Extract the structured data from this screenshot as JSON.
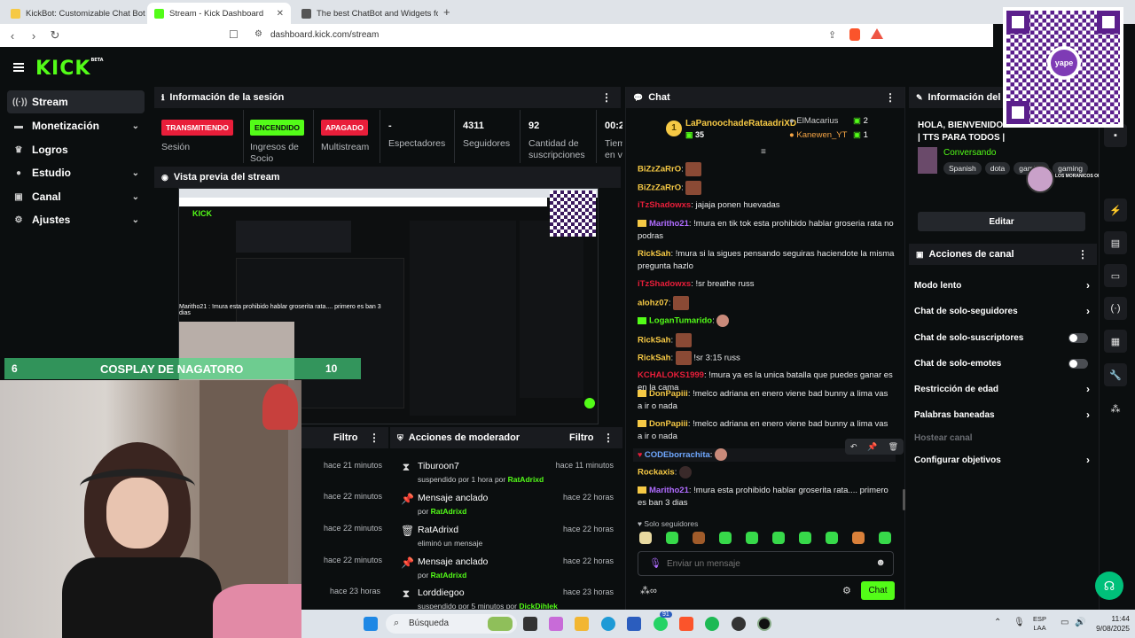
{
  "browser": {
    "tabs": [
      {
        "title": "KickBot: Customizable Chat Bot for K"
      },
      {
        "title": "Stream - Kick Dashboard"
      },
      {
        "title": "The best ChatBot and Widgets for Ki"
      }
    ],
    "url": "dashboard.kick.com/stream"
  },
  "header": {
    "logo": "KICK",
    "logo_sup": "BETA"
  },
  "sidebar": {
    "items": [
      {
        "label": "Stream",
        "icon": "stream-icon"
      },
      {
        "label": "Monetización",
        "icon": "monetization-icon"
      },
      {
        "label": "Logros",
        "icon": "trophy-icon"
      },
      {
        "label": "Estudio",
        "icon": "studio-icon"
      },
      {
        "label": "Canal",
        "icon": "channel-icon"
      },
      {
        "label": "Ajustes",
        "icon": "gear-icon"
      }
    ]
  },
  "session": {
    "title": "Información de la sesión",
    "stats": [
      {
        "badge": "TRANSMITIENDO",
        "label": "Sesión",
        "color": "#e91e3a"
      },
      {
        "badge": "ENCENDIDO",
        "label": "Ingresos de\nSocio",
        "color": "#53fc18"
      },
      {
        "badge": "APAGADO",
        "label": "Multistream",
        "color": "#e91e3a"
      },
      {
        "value": "-",
        "label": "Espectadores"
      },
      {
        "value": "4311",
        "label": "Seguidores"
      },
      {
        "value": "92",
        "label": "Cantidad de\nsuscripciones"
      },
      {
        "value": "00:2",
        "label": "Tiem\nen vi"
      }
    ]
  },
  "preview": {
    "title": "Vista previa del stream"
  },
  "left_actions": {
    "filter": "Filtro",
    "times": [
      "hace 21 minutos",
      "hace 22 minutos",
      "hace 22 minutos",
      "hace 22 minutos",
      "hace 23 horas"
    ]
  },
  "mod_actions": {
    "title": "Acciones de moderador",
    "filter": "Filtro",
    "rows": [
      {
        "icon": "hourglass-icon",
        "title": "Tiburoon7",
        "sub_pre": "suspendido por 1 hora por ",
        "sub_user": "RatAdrixd",
        "time": "hace 11 minutos"
      },
      {
        "icon": "pin-icon",
        "title": "Mensaje anclado",
        "sub_pre": "por ",
        "sub_user": "RatAdrixd",
        "time": "hace 22 horas"
      },
      {
        "icon": "trash-icon",
        "title": "RatAdrixd",
        "sub_pre": "eliminó un mensaje",
        "sub_user": "",
        "time": "hace 22 horas"
      },
      {
        "icon": "pin-icon",
        "title": "Mensaje anclado",
        "sub_pre": "por ",
        "sub_user": "RatAdrixd",
        "time": "hace 22 horas"
      },
      {
        "icon": "hourglass-icon",
        "title": "Lorddiegoo",
        "sub_pre": "suspendido por 5 minutos por ",
        "sub_user": "DickDihlek",
        "time": "hace 23 horas"
      }
    ]
  },
  "chat": {
    "title": "Chat",
    "top_gifter": {
      "rank": "1",
      "name": "LaPanoochadeRataadriXD",
      "count": "35"
    },
    "gifters": [
      {
        "name": "ElMacarius",
        "count": "2"
      },
      {
        "name": "Kanewen_YT",
        "count": "1"
      }
    ],
    "messages": [
      {
        "user": "BiZzZaRrO",
        "color": "#f6c945",
        "text": ""
      },
      {
        "user": "BiZzZaRrO",
        "color": "#f6c945",
        "text": ""
      },
      {
        "user": "iTzShadowxs",
        "color": "#e91e3a",
        "text": "jajaja ponen huevadas"
      },
      {
        "user": "Maritho21",
        "color": "#b06cff",
        "text": "!mura en tik tok esta prohibido hablar groseria rata no podras"
      },
      {
        "user": "RickSah",
        "color": "#f6c945",
        "text": "!mura si la sigues pensando seguiras haciendote la misma pregunta hazlo"
      },
      {
        "user": "iTzShadowxs",
        "color": "#e91e3a",
        "text": "!sr breathe russ"
      },
      {
        "user": "alohz07",
        "color": "#f6c945",
        "text": ""
      },
      {
        "user": "LoganTumarido",
        "color": "#53fc18",
        "text": ""
      },
      {
        "user": "RickSah",
        "color": "#f6c945",
        "text": ""
      },
      {
        "user": "RickSah",
        "color": "#f6c945",
        "text": "!sr 3:15 russ"
      },
      {
        "user": "KCHALOKS1999",
        "color": "#e91e3a",
        "text": "!mura ya es la unica batalla que puedes ganar es en la cama"
      },
      {
        "user": "DonPapiii",
        "color": "#f6c945",
        "text": "!melco adriana en enero viene bad bunny a lima vas a ir o nada"
      },
      {
        "user": "CODEborrachita",
        "color": "#6fa8ff",
        "text": ""
      },
      {
        "user": "Rockaxis",
        "color": "#f6c945",
        "text": ""
      },
      {
        "user": "Maritho21",
        "color": "#b06cff",
        "text": "!mura esta prohibido hablar groserita rata.... primero es ban 3 dias"
      }
    ],
    "followers_only": "Solo seguidores",
    "input_placeholder": "Enviar un mensaje",
    "send_label": "Chat"
  },
  "info_panel": {
    "title": "Información del",
    "stream_title": "HOLA, BIENVENIDO\n| TTS PARA TODOS |",
    "category": "Conversando",
    "tags": [
      "Spanish",
      "dota",
      "gaming",
      "gaming"
    ],
    "edit_label": "Editar"
  },
  "channel_actions": {
    "title": "Acciones de canal",
    "items": [
      {
        "label": "Modo lento",
        "control": "chevron"
      },
      {
        "label": "Chat de solo-seguidores",
        "control": "chevron"
      },
      {
        "label": "Chat de solo-suscriptores",
        "control": "toggle"
      },
      {
        "label": "Chat de solo-emotes",
        "control": "toggle"
      },
      {
        "label": "Restricción de edad",
        "control": "chevron"
      },
      {
        "label": "Palabras baneadas",
        "control": "chevron"
      },
      {
        "label": "Hostear canal",
        "control": "disabled"
      },
      {
        "label": "Configurar objetivos",
        "control": "chevron"
      }
    ]
  },
  "overlay": {
    "cosplay_left": "6",
    "cosplay_text": "COSPLAY DE NAGATORO",
    "cosplay_right": "10",
    "yape": "yape",
    "moranicos": "LOS MORANICOS OFICIAL"
  },
  "taskbar": {
    "search": "Búsqueda",
    "lang1": "ESP",
    "lang2": "LAA",
    "time": "11:44",
    "date": "9/08/2025",
    "badge": "91"
  },
  "colors": {
    "kick_green": "#53fc18",
    "live_red": "#e91e3a",
    "bg": "#0b0e0f",
    "panel_header": "#191b1f"
  }
}
